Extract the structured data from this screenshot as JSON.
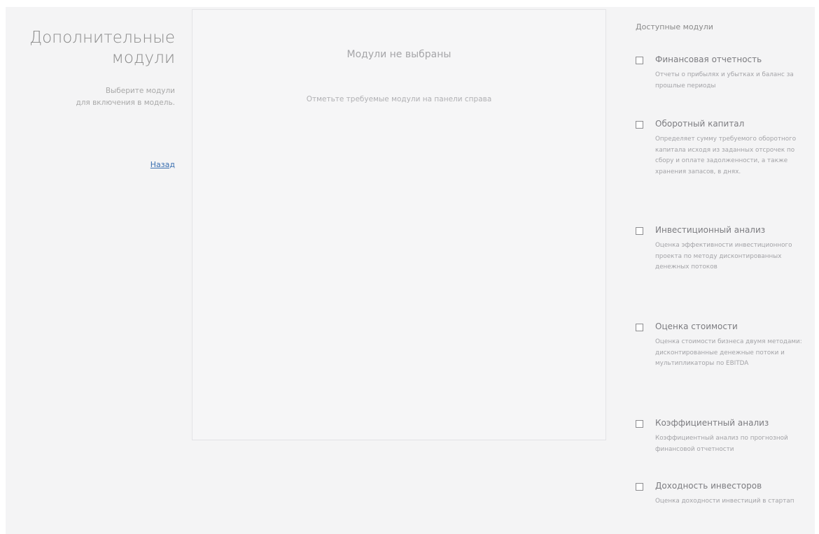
{
  "sidebar": {
    "title_line1": "Дополнительные",
    "title_line2": "модули",
    "subtitle_line1": "Выберите модули",
    "subtitle_line2": "для включения в модель.",
    "back_link": "Назад"
  },
  "main": {
    "empty_title": "Модули не выбраны",
    "empty_hint": "Отметьте требуемые модули на панели справа"
  },
  "modules_panel": {
    "header": "Доступные модули",
    "modules": [
      {
        "title": "Финансовая отчетность",
        "description": "Отчеты о прибылях и убытках и баланс за прошлые периоды",
        "checked": false
      },
      {
        "title": "Оборотный капитал",
        "description": "Определяет сумму требуемого оборотного капитала исходя из заданных отсрочек по сбору и оплате задолженности, а также хранения запасов, в днях.",
        "checked": false
      },
      {
        "title": "Инвестиционный анализ",
        "description": "Оценка эффективности инвестиционного проекта по методу дисконтированных денежных потоков",
        "checked": false
      },
      {
        "title": "Оценка стоимости",
        "description": "Оценка стоимости бизнеса двумя методами: дисконтированные денежные потоки и мультипликаторы по EBITDA",
        "checked": false
      },
      {
        "title": "Коэффициентный анализ",
        "description": "Коэффициентный анализ по прогнозной финансовой отчетности",
        "checked": false
      },
      {
        "title": "Доходность инвесторов",
        "description": "Оценка доходности инвестиций в стартап",
        "checked": false
      }
    ]
  },
  "colors": {
    "background": "#f4f4f5",
    "panel": "#f6f6f7",
    "link": "#3a6fb0",
    "text": "#8a8a8a"
  }
}
